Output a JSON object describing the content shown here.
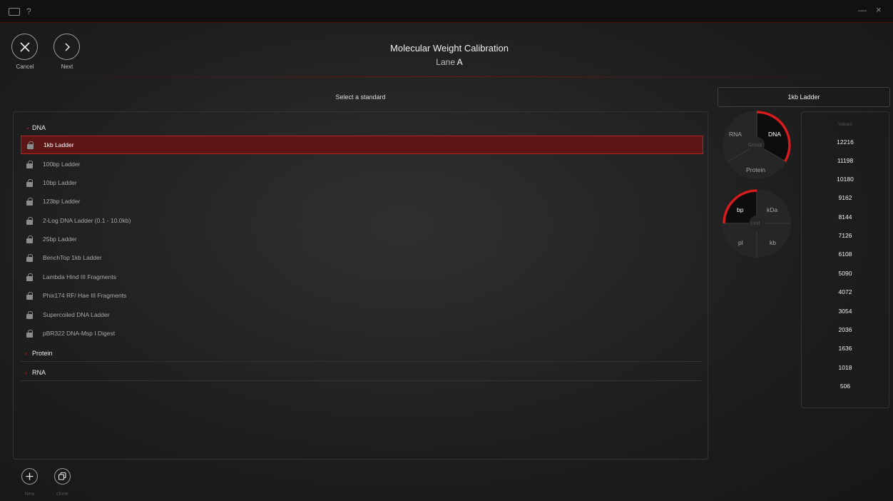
{
  "window": {
    "help_label": "?",
    "minimize_label": "—",
    "close_label": "×"
  },
  "header": {
    "cancel_label": "Cancel",
    "next_label": "Next",
    "title": "Molecular Weight Calibration",
    "lane_prefix": "Lane",
    "lane_value": "A"
  },
  "section_title": "Select a standard",
  "selected_standard": "1kb Ladder",
  "groups": [
    {
      "name": "DNA",
      "items": [
        "1kb Ladder",
        "100bp Ladder",
        "10bp Ladder",
        "123bp Ladder",
        "2-Log DNA Ladder (0.1 - 10.0kb)",
        "25bp Ladder",
        "BenchTop 1kb Ladder",
        "Lambda Hind III Fragments",
        "Phix174 RF/ Hae III Fragments",
        "Supercoiled DNA Ladder",
        "pBR322 DNA-Msp I Digest"
      ]
    },
    {
      "name": "Protein",
      "items": []
    },
    {
      "name": "RNA",
      "items": []
    }
  ],
  "group_dial": {
    "center": "Group",
    "options": [
      "RNA",
      "DNA",
      "Protein"
    ],
    "selected": "DNA"
  },
  "unit_dial": {
    "center": "Unit",
    "options": [
      "bp",
      "kDa",
      "pl",
      "kb"
    ],
    "selected": "bp"
  },
  "values": {
    "header": "Values",
    "items": [
      "12216",
      "11198",
      "10180",
      "9162",
      "8144",
      "7126",
      "6108",
      "5090",
      "4072",
      "3054",
      "2036",
      "1636",
      "1018",
      "506"
    ]
  },
  "bottom": {
    "new_label": "New",
    "clone_label": "clone"
  },
  "colors": {
    "accent": "#c21a1a",
    "selected_bg": "#5c1616",
    "background": "#1e1e1e"
  }
}
